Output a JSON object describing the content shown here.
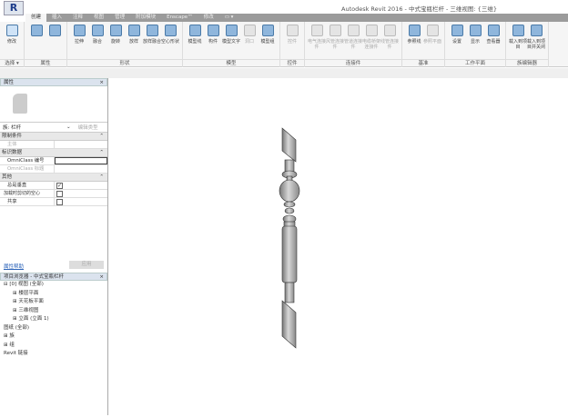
{
  "title": "Autodesk Revit 2016 -    中式宝瓶栏杆 - 三维视图: {三维}",
  "tabs": [
    "创建",
    "插入",
    "注释",
    "视图",
    "管理",
    "附加模块",
    "Enscape™",
    "修改",
    "▭ ▾"
  ],
  "ribbon": {
    "groups": [
      {
        "label": "选择 ▾",
        "buttons": [
          {
            "label": "修改",
            "state": "sel"
          }
        ]
      },
      {
        "label": "属性",
        "buttons": [
          {
            "label": "",
            "state": ""
          },
          {
            "label": "",
            "state": ""
          }
        ]
      },
      {
        "label": "形状",
        "buttons": [
          {
            "label": "拉伸"
          },
          {
            "label": "融合"
          },
          {
            "label": "旋转"
          },
          {
            "label": "放样"
          },
          {
            "label": "放样融合"
          },
          {
            "label": "空心形状"
          }
        ]
      },
      {
        "label": "模型",
        "buttons": [
          {
            "label": "模型线"
          },
          {
            "label": "构件"
          },
          {
            "label": "模型文字"
          },
          {
            "label": "洞口",
            "state": "dis"
          },
          {
            "label": "模型组"
          }
        ]
      },
      {
        "label": "控件",
        "buttons": [
          {
            "label": "控件",
            "state": "dis"
          }
        ]
      },
      {
        "label": "连接件",
        "buttons": [
          {
            "label": "电气连接件",
            "state": "dis"
          },
          {
            "label": "风管连接件",
            "state": "dis"
          },
          {
            "label": "管道连接件",
            "state": "dis"
          },
          {
            "label": "电缆桥架连接件",
            "state": "dis"
          },
          {
            "label": "线管连接件",
            "state": "dis"
          }
        ]
      },
      {
        "label": "基准",
        "buttons": [
          {
            "label": "参照线"
          },
          {
            "label": "参照平面",
            "state": "dis"
          }
        ]
      },
      {
        "label": "工作平面",
        "buttons": [
          {
            "label": "设置"
          },
          {
            "label": "显示"
          },
          {
            "label": "查看器"
          }
        ]
      },
      {
        "label": "族编辑器",
        "buttons": [
          {
            "label": "载入到项目"
          },
          {
            "label": "载入到项目并关闭"
          }
        ]
      }
    ]
  },
  "properties": {
    "title": "属性",
    "close": "×",
    "type": "族: 栏杆",
    "edit_type": "编辑类型",
    "cat1": "限制条件",
    "host": "主体",
    "cat2": "标识数据",
    "omni_num": "OmniClass 编号",
    "omni_title": "OmniClass 标题",
    "cat3": "其他",
    "always_vertical": "总是垂直",
    "cut_void": "加载时剪切的空心",
    "shared": "共享",
    "help": "属性帮助",
    "apply": "应用"
  },
  "browser": {
    "title": "项目浏览器 - 中式宝瓶栏杆",
    "close": "×",
    "items": [
      "⊟ [0] 视图 (全部)",
      "⊞ 楼层平面",
      "⊞ 天花板平面",
      "⊞ 三维视图",
      "⊞ 立面 (立面 1)",
      "图纸 (全部)",
      "⊞ 族",
      "⊞ 组",
      "Revit 链接"
    ]
  }
}
